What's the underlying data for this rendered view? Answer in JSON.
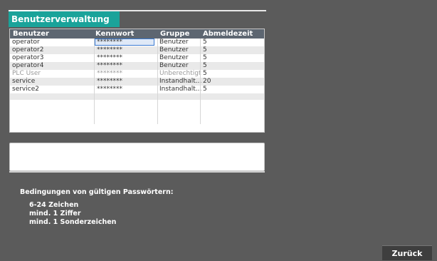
{
  "panel": {
    "title": "Benutzerverwaltung"
  },
  "table": {
    "headers": [
      "Benutzer",
      "Kennwort",
      "Gruppe",
      "Abmeldezeit"
    ],
    "rows": [
      {
        "user": "operator",
        "password": "********",
        "group": "Benutzer",
        "logout": "5"
      },
      {
        "user": "operator2",
        "password": "********",
        "group": "Benutzer",
        "logout": "5"
      },
      {
        "user": "operator3",
        "password": "********",
        "group": "Benutzer",
        "logout": "5"
      },
      {
        "user": "operator4",
        "password": "********",
        "group": "Benutzer",
        "logout": "5"
      },
      {
        "user": "PLC User",
        "password": "********",
        "group": "Unberechtigt",
        "logout": "5"
      },
      {
        "user": "service",
        "password": "********",
        "group": "Instandhalt...",
        "logout": "20"
      },
      {
        "user": "service2",
        "password": "********",
        "group": "Instandhalt...",
        "logout": "5"
      }
    ]
  },
  "conditions": {
    "title": "Bedingungen von gültigen Passwörtern:",
    "lines": [
      "6-24 Zeichen",
      "mind. 1 Ziffer",
      "mind. 1 Sonderzeichen"
    ]
  },
  "buttons": {
    "back": "Zurück"
  },
  "colors": {
    "accent": "#1aa39a",
    "header": "#5d6671",
    "background": "#5b5b5b"
  }
}
